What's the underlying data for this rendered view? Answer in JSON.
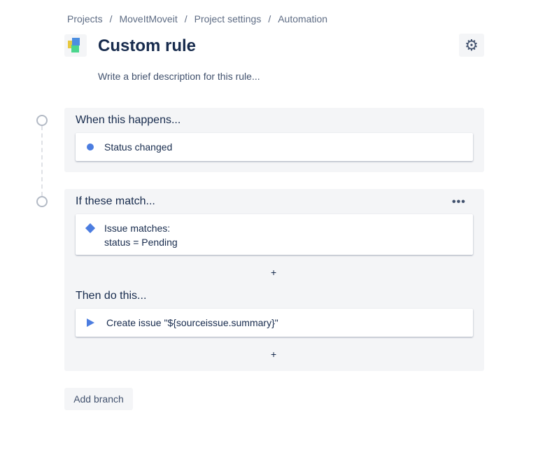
{
  "breadcrumb": [
    "Projects",
    "MoveItMoveit",
    "Project settings",
    "Automation"
  ],
  "title": "Custom rule",
  "description_placeholder": "Write a brief description for this rule...",
  "trigger": {
    "heading": "When this happens...",
    "item": "Status changed"
  },
  "condition": {
    "heading": "If these match...",
    "line1": "Issue matches:",
    "line2": "status = Pending"
  },
  "action": {
    "heading": "Then do this...",
    "item": "Create issue \"${sourceissue.summary}\""
  },
  "add_symbol": "+",
  "more_symbol": "•••",
  "add_branch": "Add branch",
  "colors": {
    "accent": "#4c7de0",
    "panel": "#f4f5f7"
  }
}
